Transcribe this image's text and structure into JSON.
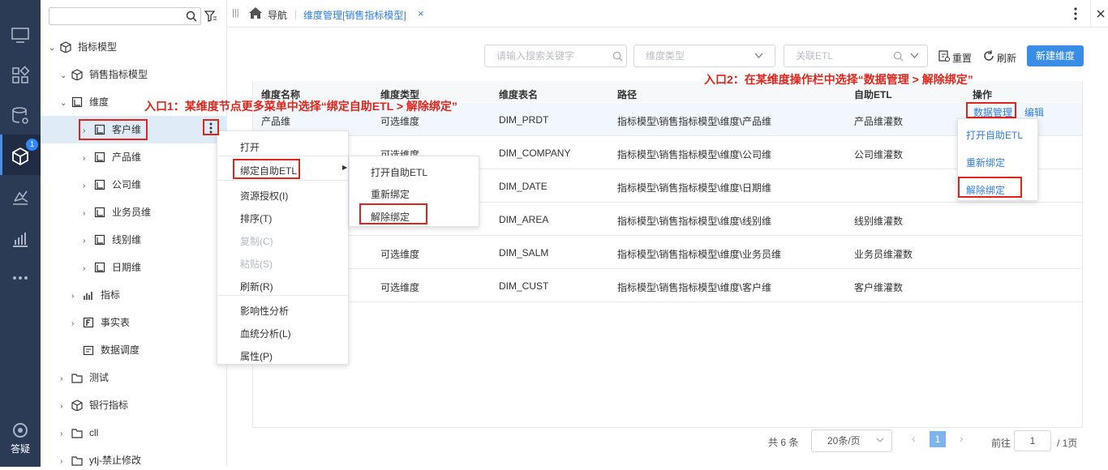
{
  "rail": {
    "badge": "1",
    "help_label": "答疑"
  },
  "tree": {
    "items": [
      {
        "label": "指标模型"
      },
      {
        "label": "销售指标模型"
      },
      {
        "label": "维度"
      },
      {
        "label": "客户维"
      },
      {
        "label": "产品维"
      },
      {
        "label": "公司维"
      },
      {
        "label": "业务员维"
      },
      {
        "label": "线别维"
      },
      {
        "label": "日期维"
      },
      {
        "label": "指标"
      },
      {
        "label": "事实表"
      },
      {
        "label": "数据调度"
      },
      {
        "label": "测试"
      },
      {
        "label": "银行指标"
      },
      {
        "label": "cll"
      },
      {
        "label": "ytj-禁止修改"
      }
    ]
  },
  "topbar": {
    "nav_label": "导航",
    "tab_label": "维度管理[销售指标模型]",
    "close": "×"
  },
  "filters": {
    "search_placeholder": "请输入搜索关键字",
    "dim_type_placeholder": "维度类型",
    "etl_placeholder": "关联ETL",
    "reset": "重置",
    "refresh": "刷新",
    "new_dim": "新建维度"
  },
  "annotations": {
    "entry1": "入口1：某维度节点更多菜单中选择“绑定自助ETL > 解除绑定”",
    "entry2": "入口2：在某维度操作栏中选择“数据管理 > 解除绑定”"
  },
  "table": {
    "headers": [
      "维度名称",
      "维度类型",
      "维度表名",
      "路径",
      "自助ETL",
      "操作"
    ],
    "rows": [
      {
        "name": "产品维",
        "type": "可选维度",
        "table": "DIM_PRDT",
        "path": "指标模型\\销售指标模型\\维度\\产品维",
        "etl": "产品维灌数"
      },
      {
        "name": "",
        "type": "可选维度",
        "table": "DIM_COMPANY",
        "path": "指标模型\\销售指标模型\\维度\\公司维",
        "etl": "公司维灌数"
      },
      {
        "name": "",
        "type": "",
        "table": "DIM_DATE",
        "path": "指标模型\\销售指标模型\\维度\\日期维",
        "etl": ""
      },
      {
        "name": "",
        "type": "",
        "table": "DIM_AREA",
        "path": "指标模型\\销售指标模型\\维度\\线别维",
        "etl": "线别维灌数"
      },
      {
        "name": "",
        "type": "可选维度",
        "table": "DIM_SALM",
        "path": "指标模型\\销售指标模型\\维度\\业务员维",
        "etl": "业务员维灌数"
      },
      {
        "name": "",
        "type": "可选维度",
        "table": "DIM_CUST",
        "path": "指标模型\\销售指标模型\\维度\\客户维",
        "etl": "客户维灌数"
      }
    ],
    "op_data_mgmt": "数据管理",
    "op_edit": "编辑"
  },
  "context_menu": {
    "items": [
      "打开",
      "绑定自助ETL",
      "资源授权(I)",
      "排序(T)",
      "复制(C)",
      "粘贴(S)",
      "刷新(R)",
      "影响性分析",
      "血统分析(L)",
      "属性(P)"
    ]
  },
  "etl_submenu": {
    "items": [
      "打开自助ETL",
      "重新绑定",
      "解除绑定"
    ]
  },
  "op_dropdown": {
    "items": [
      "打开自助ETL",
      "重新绑定",
      "解除绑定"
    ]
  },
  "pagination": {
    "total": "共 6 条",
    "page_size": "20条/页",
    "current": "1",
    "goto_label": "前往",
    "goto_value": "1",
    "pages": "/ 1页"
  },
  "colors": {
    "accent": "#2f88ff",
    "rail": "#2b3a55",
    "annotation": "#e0251b",
    "selected_row": "#dfecf8"
  }
}
